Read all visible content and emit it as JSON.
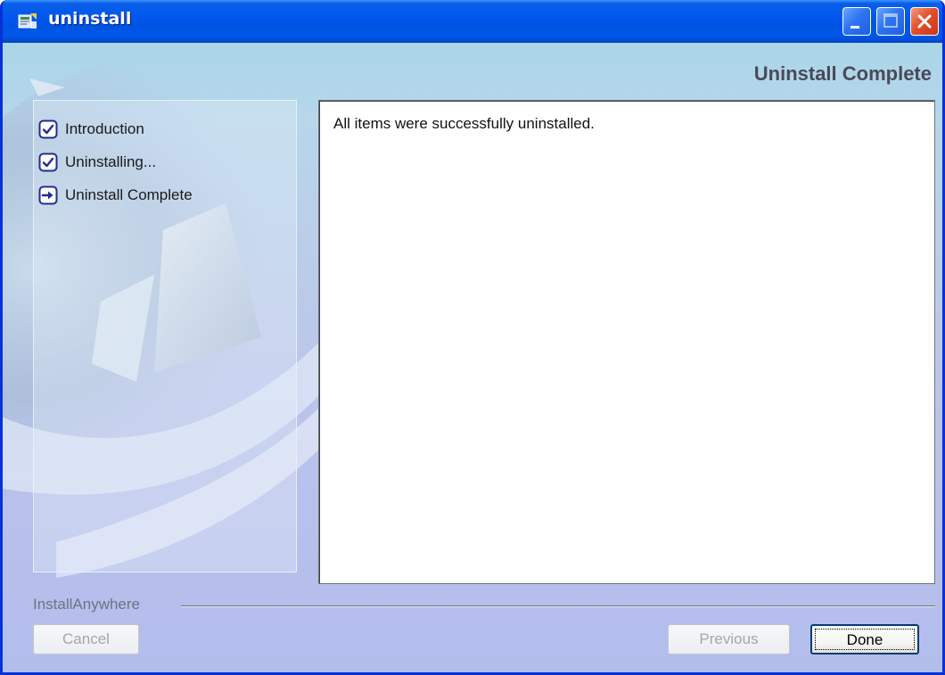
{
  "window": {
    "title": "uninstall",
    "icon": "installer-app-icon",
    "controls": [
      "minimize-icon",
      "maximize-icon",
      "close-icon"
    ]
  },
  "header": {
    "step_title": "Uninstall Complete"
  },
  "sidebar": {
    "steps": [
      {
        "label": "Introduction",
        "icon": "checkmark-icon",
        "state": "done"
      },
      {
        "label": "Uninstalling...",
        "icon": "checkmark-icon",
        "state": "done"
      },
      {
        "label": "Uninstall Complete",
        "icon": "arrow-right-icon",
        "state": "current"
      }
    ]
  },
  "content": {
    "message": "All items were successfully uninstalled."
  },
  "footer": {
    "brand": "InstallAnywhere",
    "cancel_label": "Cancel",
    "previous_label": "Previous",
    "done_label": "Done"
  },
  "colors": {
    "titlebar": "#0054e3",
    "accent": "#1f2f8c",
    "background": "#b8cde6",
    "disabled_text": "#a6a6a6"
  }
}
